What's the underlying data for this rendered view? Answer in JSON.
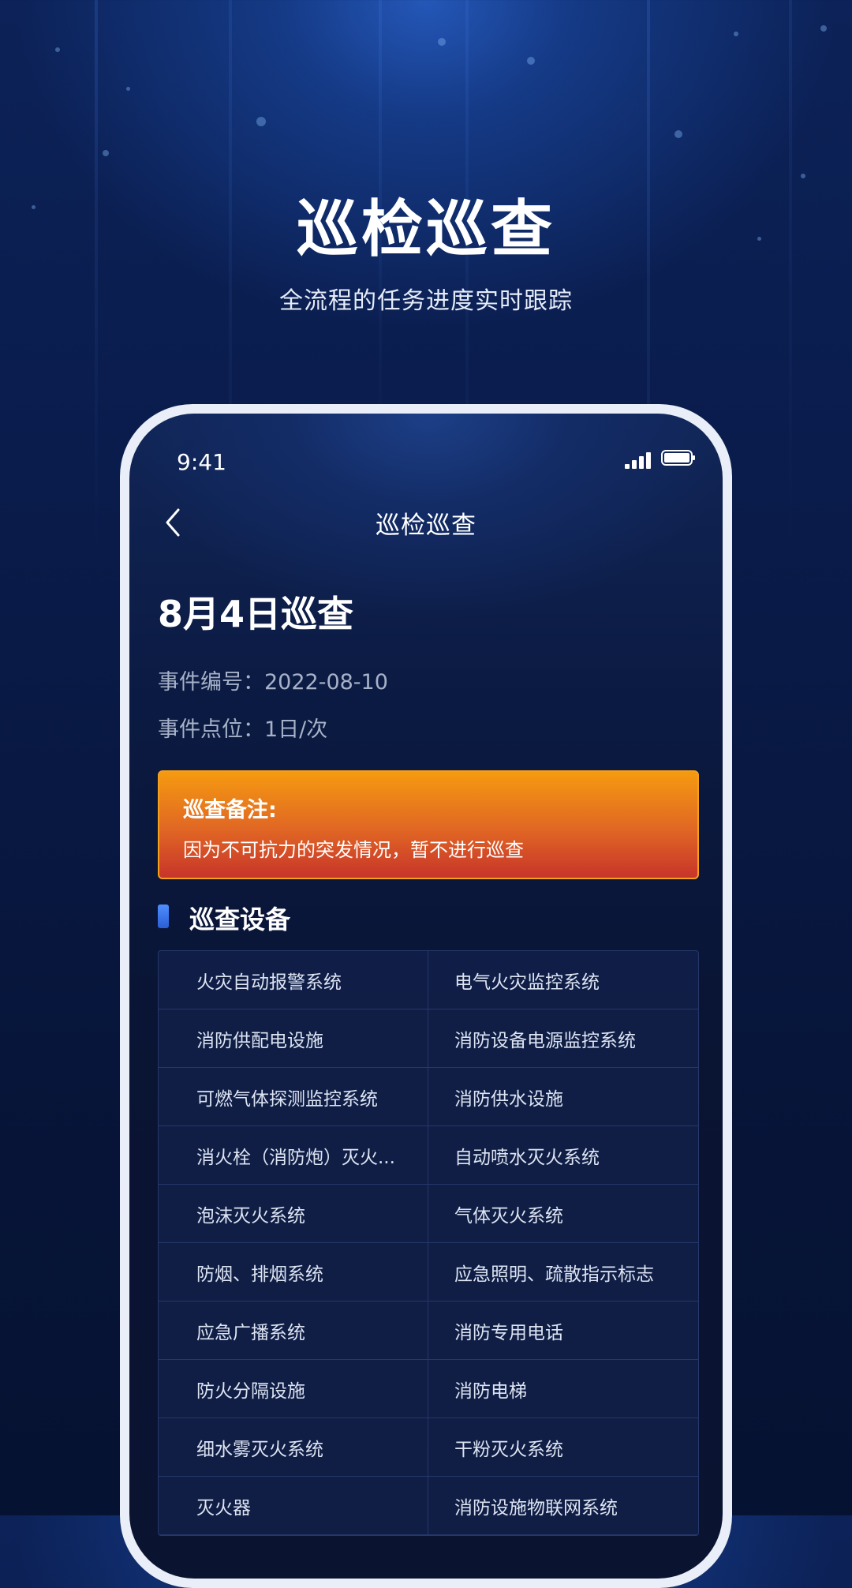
{
  "hero": {
    "title": "巡检巡查",
    "subtitle": "全流程的任务进度实时跟踪"
  },
  "status_bar": {
    "time": "9:41",
    "icons": [
      "signal-icon",
      "battery-icon"
    ]
  },
  "nav": {
    "back_icon": "chevron-left-icon",
    "title": "巡检巡查"
  },
  "record": {
    "title": "8月4日巡查",
    "event_number_label": "事件编号：",
    "event_number": "2022-08-10",
    "event_point_label": "事件点位：",
    "event_point": "1日/次"
  },
  "note": {
    "label": "巡查备注:",
    "text": "因为不可抗力的突发情况，暂不进行巡查",
    "colors": {
      "top": "#f59a10",
      "bottom": "#c8342a"
    }
  },
  "devices": {
    "title": "巡查设备",
    "items": [
      "火灾自动报警系统",
      "电气火灾监控系统",
      "消防供配电设施",
      "消防设备电源监控系统",
      "可燃气体探测监控系统",
      "消防供水设施",
      "消火栓（消防炮）灭火...",
      "自动喷水灭火系统",
      "泡沫灭火系统",
      "气体灭火系统",
      "防烟、排烟系统",
      "应急照明、疏散指示标志",
      "应急广播系统",
      "消防专用电话",
      "防火分隔设施",
      "消防电梯",
      "细水雾灭火系统",
      "干粉灭火系统",
      "灭火器",
      "消防设施物联网系统"
    ]
  },
  "theme": {
    "accent_blue": "#4f8eff",
    "background": "#0a1c4c"
  }
}
